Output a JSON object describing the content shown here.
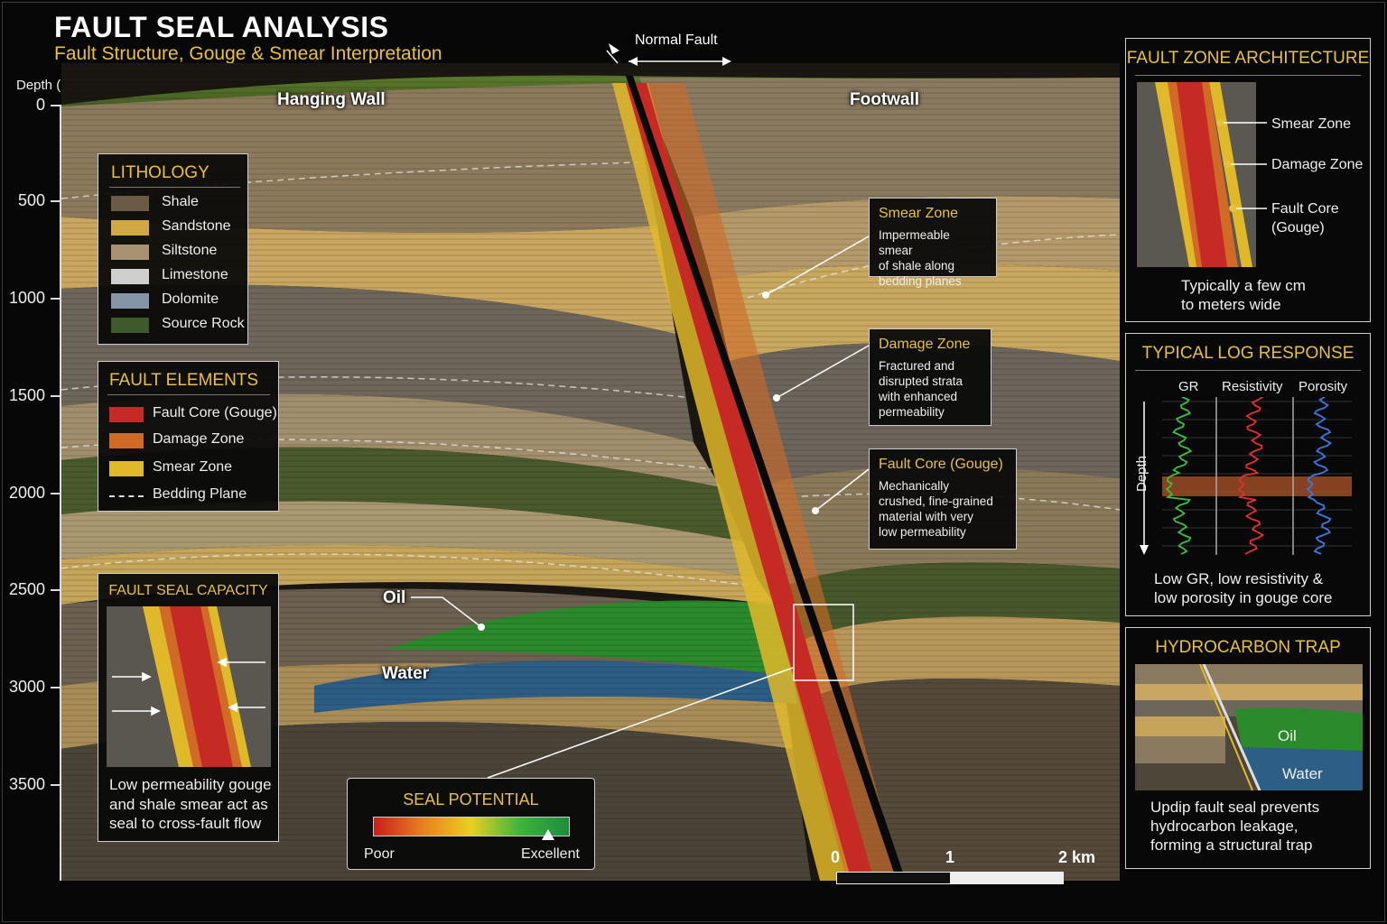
{
  "title": "FAULT SEAL ANALYSIS",
  "subtitle": "Fault Structure, Gouge & Smear Interpretation",
  "depth_axis": {
    "title": "Depth (m)",
    "ticks": [
      "0",
      "500",
      "1000",
      "1500",
      "2000",
      "2500",
      "3000",
      "3500"
    ]
  },
  "section": {
    "normal_fault_label": "Normal Fault",
    "hanging_wall_label": "Hanging Wall",
    "footwall_label": "Footwall",
    "oil_label": "Oil",
    "water_label": "Water"
  },
  "lithology": {
    "title": "LITHOLOGY",
    "items": [
      {
        "label": "Shale",
        "color": "#6b5a44"
      },
      {
        "label": "Sandstone",
        "color": "#d2a845"
      },
      {
        "label": "Siltstone",
        "color": "#a89271"
      },
      {
        "label": "Limestone",
        "color": "#cfcfcf"
      },
      {
        "label": "Dolomite",
        "color": "#8595a8"
      },
      {
        "label": "Source Rock",
        "color": "#3f5a2a"
      }
    ]
  },
  "fault_elements": {
    "title": "FAULT ELEMENTS",
    "items": [
      {
        "label": "Fault Core (Gouge)",
        "color": "#c62a24"
      },
      {
        "label": "Damage Zone",
        "color": "#d06a26"
      },
      {
        "label": "Smear Zone",
        "color": "#e0b92a"
      },
      {
        "label": "Bedding Plane",
        "color": "#dddddd"
      }
    ]
  },
  "fault_seal_capacity": {
    "title": "FAULT SEAL CAPACITY",
    "note": [
      "Low permeability gouge",
      "and shale smear act as",
      "seal to cross-fault flow"
    ]
  },
  "callouts": {
    "smear": {
      "title": "Smear Zone",
      "body": [
        "Impermeable smear",
        "of shale along",
        "bedding planes"
      ]
    },
    "damage": {
      "title": "Damage Zone",
      "body": [
        "Fractured and",
        "disrupted strata",
        "with enhanced",
        "permeability"
      ]
    },
    "core": {
      "title": "Fault Core (Gouge)",
      "body": [
        "Mechanically",
        "crushed, fine-grained",
        "material with very",
        "low permeability"
      ]
    }
  },
  "seal_potential": {
    "title": "SEAL POTENTIAL",
    "low_label": "Poor",
    "high_label": "Excellent",
    "level": 0.9,
    "colors": [
      "#c81e1e",
      "#e8801e",
      "#e8d020",
      "#3cb43c",
      "#1e8c3c"
    ]
  },
  "scale_bar": {
    "labels": [
      "0",
      "1",
      "2 km"
    ]
  },
  "fault_zone_architecture": {
    "title": "FAULT ZONE ARCHITECTURE",
    "labels": [
      "Smear Zone",
      "Damage Zone",
      "Fault Core",
      "(Gouge)"
    ],
    "note": [
      "Typically a few cm",
      "to meters wide"
    ]
  },
  "log_response": {
    "title": "TYPICAL LOG RESPONSE",
    "tracks": [
      {
        "label": "GR",
        "color": "#3cc03c"
      },
      {
        "label": "Resistivity",
        "color": "#e23030"
      },
      {
        "label": "Porosity",
        "color": "#3a7ae0"
      }
    ],
    "depth_label": "Depth",
    "note": [
      "Low GR, low resistivity &",
      "low porosity in gouge core"
    ]
  },
  "hydrocarbon_trap": {
    "title": "HYDROCARBON TRAP",
    "oil_label": "Oil",
    "water_label": "Water",
    "note": [
      "Updip fault seal prevents",
      "hydrocarbon leakage,",
      "forming a structural trap"
    ]
  }
}
